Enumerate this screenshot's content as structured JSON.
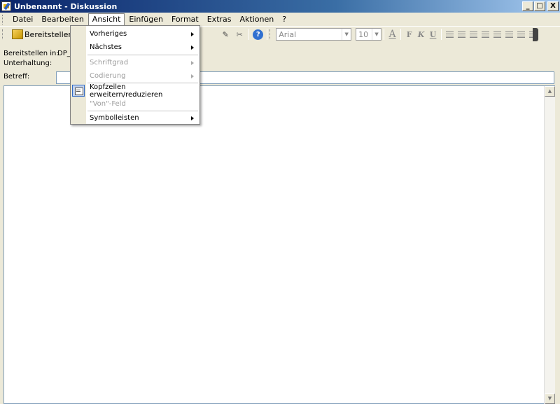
{
  "window": {
    "title": "Unbenannt - Diskussion",
    "buttons": [
      "_",
      "□",
      "X"
    ]
  },
  "menubar": {
    "items": [
      "Datei",
      "Bearbeiten",
      "Ansicht",
      "Einfügen",
      "Format",
      "Extras",
      "Aktionen",
      "?"
    ],
    "active": "Ansicht"
  },
  "toolbar": {
    "send_label": "Bereitstellen",
    "font_name": "Arial",
    "font_size": "10",
    "format_buttons": [
      "A",
      "F",
      "K",
      "U"
    ]
  },
  "header": {
    "post_in_label": "Bereitstellen in:",
    "post_in_value": "DP_F",
    "conversation_label": "Unterhaltung:",
    "subject_label": "Betreff:",
    "subject_value": ""
  },
  "dropdown": {
    "items": [
      {
        "label": "Vorheriges",
        "submenu": true,
        "disabled": false
      },
      {
        "label": "Nächstes",
        "submenu": true,
        "disabled": false
      },
      {
        "label": "Schriftgrad",
        "submenu": true,
        "disabled": true
      },
      {
        "label": "Codierung",
        "submenu": true,
        "disabled": true
      },
      {
        "label": "Kopfzeilen erweitern/reduzieren",
        "submenu": false,
        "disabled": false,
        "icon": "header-toggle-icon"
      },
      {
        "label": "\"Von\"-Feld",
        "submenu": false,
        "disabled": true
      },
      {
        "label": "Symbolleisten",
        "submenu": true,
        "disabled": false
      }
    ]
  },
  "colors": {
    "titlebar_start": "#0a246a",
    "window_bg": "#ece9d8",
    "disabled_text": "#9e9e9e"
  }
}
